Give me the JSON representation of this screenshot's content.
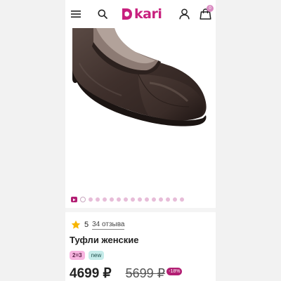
{
  "header": {
    "logo_text": "kari",
    "cart_count": "0",
    "colors": {
      "brand": "#c8207e"
    },
    "icons": [
      "menu-icon",
      "search-icon",
      "user-icon",
      "shopping-bag-icon"
    ]
  },
  "gallery": {
    "image_count": 15,
    "active_index": 1
  },
  "product": {
    "rating": "5",
    "reviews": "34 отзыва",
    "title": "Туфли женские",
    "badges": {
      "promo": "2=3",
      "new": "new"
    },
    "price": "4699 ₽",
    "old_price": "5699 ₽",
    "discount": "-18%"
  }
}
